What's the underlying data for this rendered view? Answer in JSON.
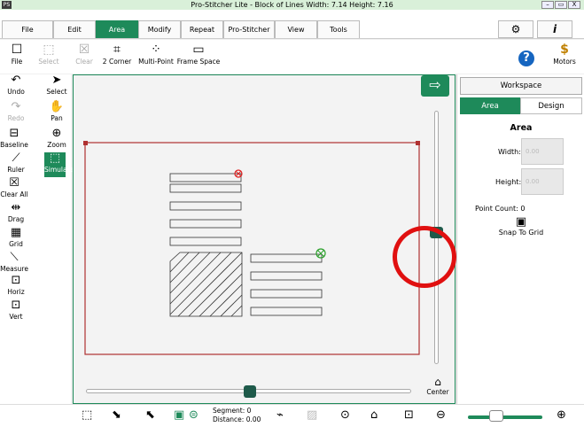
{
  "titlebar": {
    "app_icon": "PS",
    "title": "Pro-Stitcher Lite  -  Block of Lines  Width: 7.14  Height: 7.16",
    "minimize": "–",
    "restore": "▭",
    "close": "X"
  },
  "menu": {
    "tabs": [
      "File",
      "Edit",
      "Area",
      "Modify",
      "Repeat",
      "Pro-Stitcher",
      "View",
      "Tools"
    ],
    "active": "Area"
  },
  "toolbar": {
    "file": "File",
    "select": "Select",
    "clear": "Clear",
    "two_corner": "2 Corner",
    "multi_point": "Multi-Point",
    "frame_space": "Frame Space",
    "motors": "Motors"
  },
  "left_tools": {
    "undo": "Undo",
    "select": "Select",
    "redo": "Redo",
    "pan": "Pan",
    "baseline": "Baseline",
    "zoom": "Zoom",
    "ruler": "Ruler",
    "simulate": "Simulate",
    "clear_all": "Clear All",
    "drag": "Drag",
    "grid": "Grid",
    "measure": "Measure",
    "horiz": "Horiz",
    "vert": "Vert"
  },
  "workspace": {
    "center_label": "Center",
    "arrow_icon": "⇨"
  },
  "right_panel": {
    "workspace_button": "Workspace",
    "tabs": [
      "Area",
      "Design"
    ],
    "active_tab": "Area",
    "title": "Area",
    "width_label": "Width:",
    "width_value": "0.00",
    "height_label": "Height:",
    "height_value": "0.00",
    "point_count_label": "Point Count:",
    "point_count_value": "0",
    "snap_label": "Snap To Grid"
  },
  "bottom": {
    "segment_label": "Segment:",
    "segment_value": "0",
    "distance_label": "Distance:",
    "distance_value": "0.00"
  },
  "colors": {
    "accent": "#1e8a5a",
    "boundary": "#b03030",
    "annotation": "#e01010"
  }
}
